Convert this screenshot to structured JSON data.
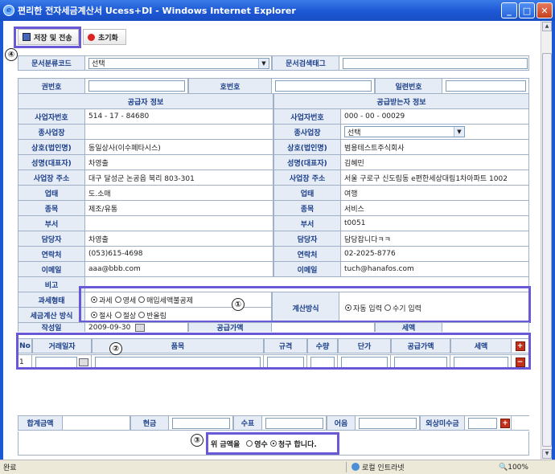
{
  "window": {
    "title": "편리한 전자세금계산서 Ucess+DI - Windows Internet Explorer"
  },
  "toolbar": {
    "save": "저장 및 전송",
    "reset": "초기화"
  },
  "annotations": [
    "④",
    "①",
    "②",
    "③"
  ],
  "doc": {
    "class_label": "문서분류코드",
    "class_value": "선택",
    "search_label": "문서검색태그",
    "search_value": ""
  },
  "book": {
    "vol": "권번호",
    "no": "호번호",
    "serial": "일련번호"
  },
  "sections": {
    "supplier": "공급자 정보",
    "buyer": "공급받는자 정보"
  },
  "rows": [
    {
      "l": "사업자번호",
      "s": "514  -  17  -  84680",
      "bl": "사업자번호",
      "b": "000  -  00  -  00029"
    },
    {
      "l": "종사업장",
      "s": "",
      "bl": "종사업장",
      "b": "선택"
    },
    {
      "l": "상호(법인명)",
      "s": "동일상사(이수페타시스)",
      "bl": "상호(법인명)",
      "b": "범용테스트주식회사"
    },
    {
      "l": "성명(대표자)",
      "s": "차영출",
      "bl": "성명(대표자)",
      "b": "김혜민"
    },
    {
      "l": "사업장 주소",
      "s": "대구 달성군 논공읍 북리  803-301",
      "bl": "사업장 주소",
      "b": "서울 구로구 신도림동 e편한세상대림1차아파트 1002"
    },
    {
      "l": "업태",
      "s": "도.소매",
      "bl": "업태",
      "b": "여행"
    },
    {
      "l": "종목",
      "s": "제조/유통",
      "bl": "종목",
      "b": "서비스"
    },
    {
      "l": "부서",
      "s": "",
      "bl": "부서",
      "b": "t0051"
    },
    {
      "l": "담당자",
      "s": "차영출",
      "bl": "담당자",
      "b": "담당잡니다ㅋㅋ"
    },
    {
      "l": "연락처",
      "s": "(053)615-4698",
      "bl": "연락처",
      "b": "02-2025-8776"
    },
    {
      "l": "이메일",
      "s": "aaa@bbb.com",
      "bl": "이메일",
      "b": "tuch@hanafos.com"
    }
  ],
  "memo": {
    "label": "비고"
  },
  "tax": {
    "type_label": "과세형태",
    "opts": [
      "과세",
      "영세",
      "매입세액불공제"
    ],
    "method_label": "세금계산 방식",
    "methods": [
      "절사",
      "절상",
      "반올림"
    ],
    "calc_label": "계산방식",
    "calc": [
      "자동 입력",
      "수기 입력"
    ]
  },
  "date": {
    "label": "작성일",
    "value": "2009-09-30",
    "supply": "공급가액",
    "taxlbl": "세액"
  },
  "items": {
    "cols": [
      "No",
      "거래일자",
      "품목",
      "규격",
      "수량",
      "단가",
      "공급가액",
      "세액"
    ],
    "row1_no": "1"
  },
  "totals": {
    "sum": "합계금액",
    "cash": "현금",
    "check": "수표",
    "bill": "어음",
    "credit": "외상미수금"
  },
  "amount": {
    "prefix": "위 금액을",
    "opts": [
      "영수",
      "청구 합니다."
    ]
  },
  "status": {
    "left": "완료",
    "zone": "로컬 인트라넷",
    "zoom": "100%"
  }
}
